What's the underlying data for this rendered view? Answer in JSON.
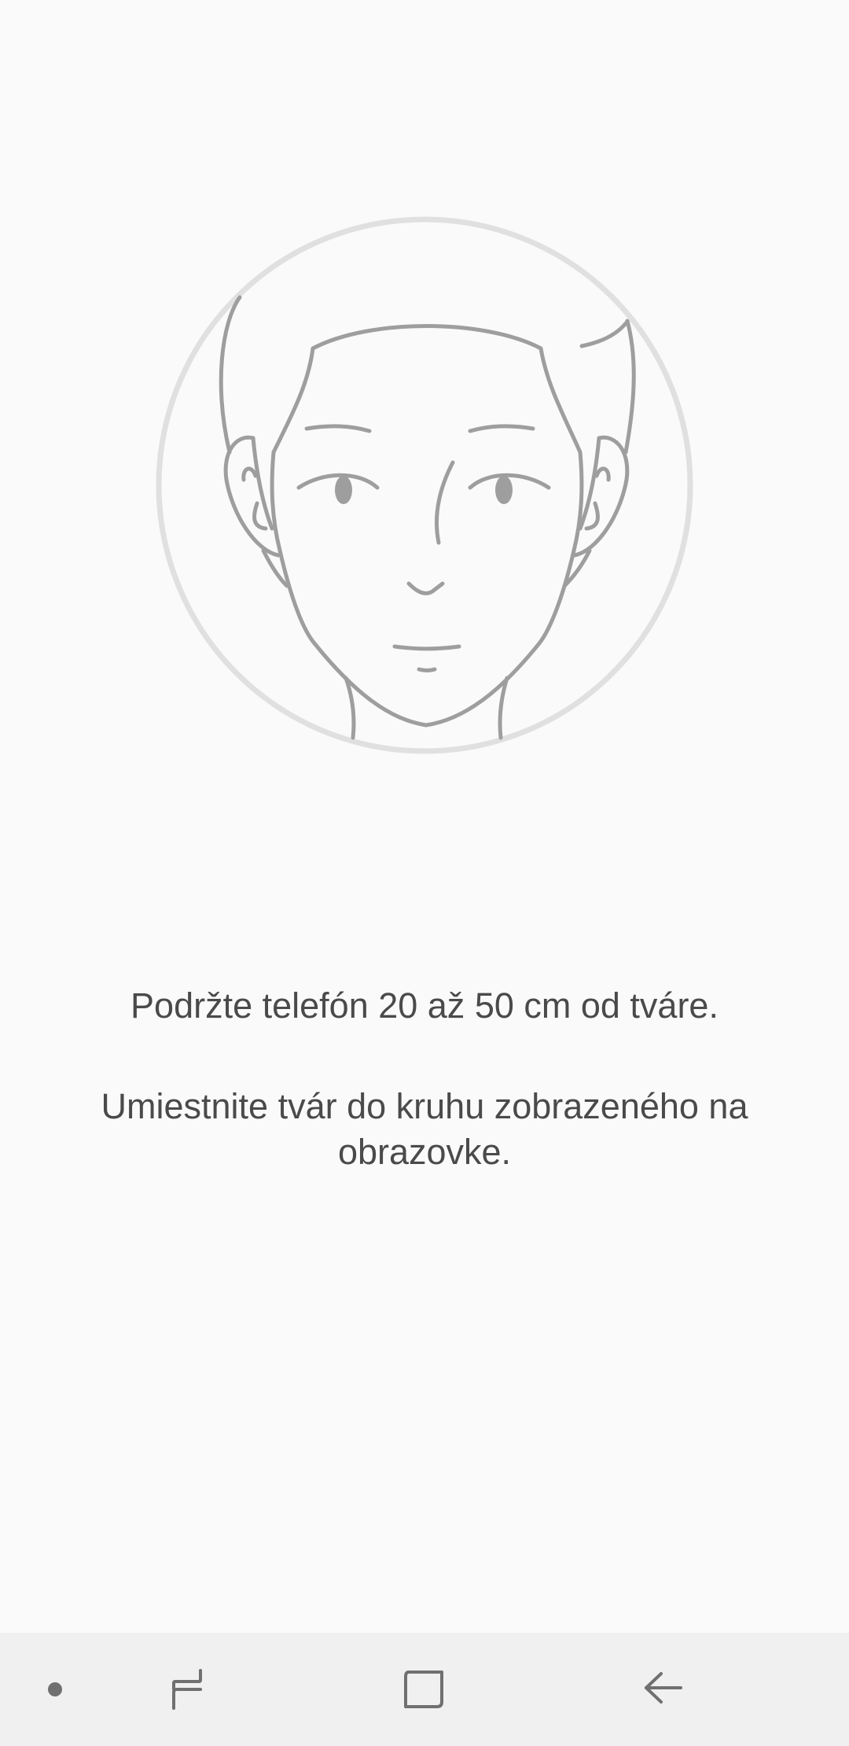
{
  "instructions": {
    "distance": "Podržte telefón 20 až 50 cm od tváre.",
    "position": "Umiestnite tvár do kruhu zobrazeného na obrazovke."
  },
  "navigation": {
    "dot_icon": "dot-indicator-icon",
    "recents_icon": "recent-apps-icon",
    "home_icon": "home-icon",
    "back_icon": "back-icon"
  },
  "colors": {
    "background": "#fafafa",
    "nav_background": "#f0f0f0",
    "circle": "#e0e0e0",
    "face_lines": "#9e9e9e",
    "text": "#4a4a4a",
    "nav_icon": "#707070"
  }
}
